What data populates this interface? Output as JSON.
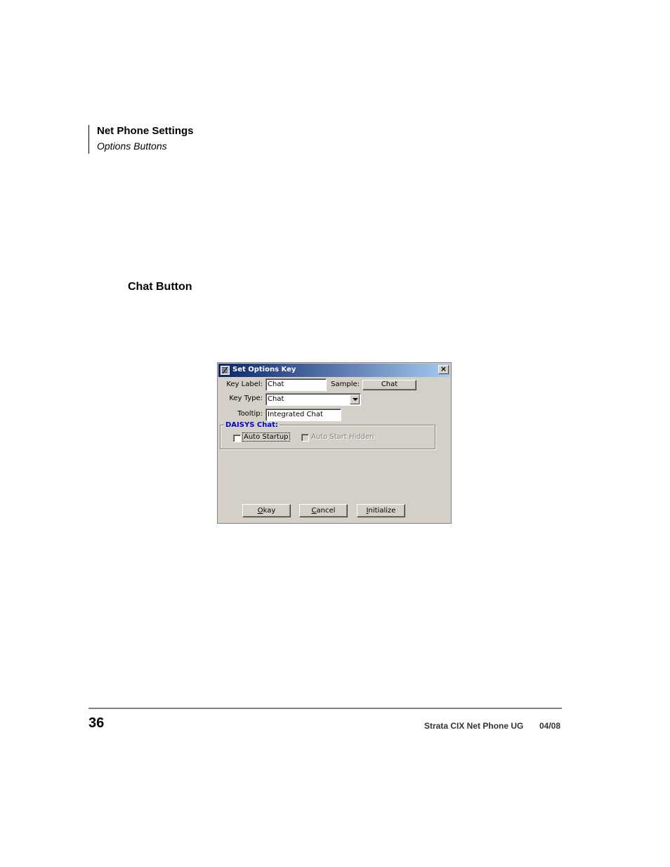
{
  "header": {
    "title": "Net Phone Settings",
    "subtitle": "Options Buttons"
  },
  "section": {
    "title": "Chat Button"
  },
  "dialog": {
    "title": "Set Options Key",
    "close_glyph": "×",
    "key_label": {
      "label": "Key Label:",
      "value": "Chat"
    },
    "sample": {
      "label": "Sample:",
      "button_label": "Chat"
    },
    "key_type": {
      "label": "Key Type:",
      "selected": "Chat"
    },
    "tooltip": {
      "label": "Tooltip:",
      "value": "Integrated Chat"
    },
    "group": {
      "title": "DAISYS Chat:",
      "auto_startup": {
        "label": "Auto Startup",
        "checked": false,
        "enabled": true
      },
      "auto_start_hidden": {
        "label": "Auto Start Hidden",
        "checked": false,
        "enabled": false
      }
    },
    "buttons": {
      "okay": {
        "mnemonic": "O",
        "rest": "kay"
      },
      "cancel": {
        "mnemonic": "C",
        "rest": "ancel"
      },
      "initialize": {
        "mnemonic": "I",
        "rest": "nitialize"
      }
    }
  },
  "footer": {
    "page_number": "36",
    "doc_title": "Strata CIX Net Phone UG",
    "date": "04/08"
  }
}
